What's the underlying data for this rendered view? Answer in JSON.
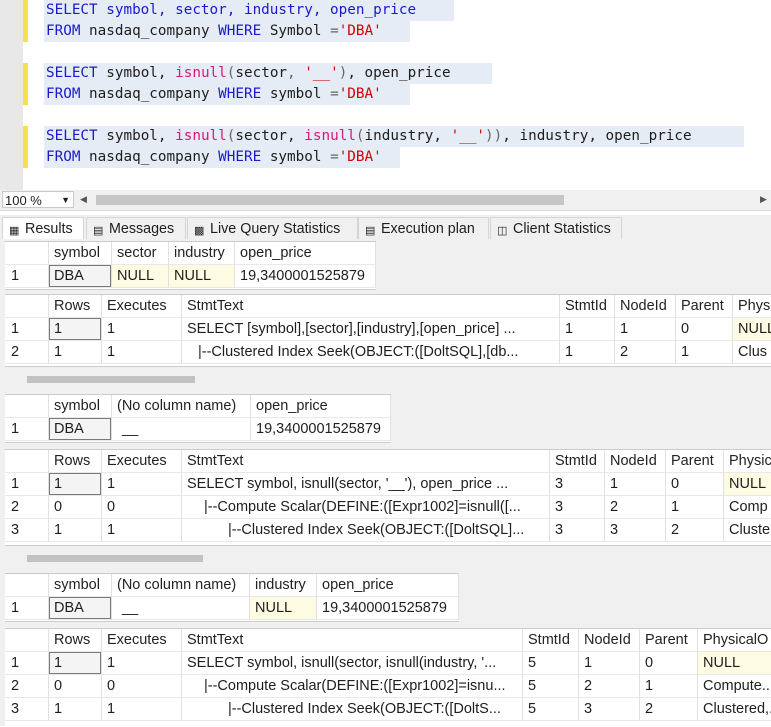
{
  "editor": {
    "q1_select": "SELECT symbol, sector, industry, open_price",
    "q1_from_kw1": "FROM",
    "q1_from_mid": " nasdaq_company ",
    "q1_where": "WHERE",
    "q1_col": " Symbol ",
    "q1_eq": "=",
    "q1_val": "'DBA'",
    "q2_sel_kw": "SELECT",
    "q2_a": " symbol, ",
    "q2_fn": "isnull",
    "q2_b": "(",
    "q2_c": "sector",
    "q2_d": ", ",
    "q2_str": "'__'",
    "q2_e": ")",
    "q2_f": ", open_price",
    "q2_from_kw1": "FROM",
    "q2_from_mid": " nasdaq_company ",
    "q2_where": "WHERE",
    "q2_col": " symbol ",
    "q2_eq": "=",
    "q2_val": "'DBA'",
    "q3_sel_kw": "SELECT",
    "q3_a": " symbol, ",
    "q3_fn1": "isnull",
    "q3_b": "(",
    "q3_c": "sector, ",
    "q3_fn2": "isnull",
    "q3_d": "(",
    "q3_e": "industry, ",
    "q3_str": "'__'",
    "q3_f": "))",
    "q3_g": ", industry, open_price",
    "q3_from_kw1": "FROM",
    "q3_from_mid": " nasdaq_company ",
    "q3_where": "WHERE",
    "q3_col": " symbol ",
    "q3_eq": "=",
    "q3_val": "'DBA'"
  },
  "zoom": {
    "value": "100 %"
  },
  "tabs": [
    "Results",
    "Messages",
    "Live Query Statistics",
    "Execution plan",
    "Client Statistics"
  ],
  "grid1": {
    "headers": [
      "symbol",
      "sector",
      "industry",
      "open_price"
    ],
    "row": [
      "1",
      "DBA",
      "NULL",
      "NULL",
      "19,3400001525879"
    ]
  },
  "plan1": {
    "headers": [
      "Rows",
      "Executes",
      "StmtText",
      "StmtId",
      "NodeId",
      "Parent",
      "Phys"
    ],
    "rows": [
      [
        "1",
        "1",
        "1",
        "SELECT [symbol],[sector],[industry],[open_price] ...",
        "1",
        "1",
        "0",
        "NULL"
      ],
      [
        "2",
        "1",
        "1",
        "|--Clustered Index Seek(OBJECT:([DoltSQL],[db...",
        "1",
        "2",
        "1",
        "Clus"
      ]
    ]
  },
  "grid2": {
    "headers": [
      "symbol",
      "(No column name)",
      "open_price"
    ],
    "row": [
      "1",
      "DBA",
      "__",
      "19,3400001525879"
    ]
  },
  "plan2": {
    "headers": [
      "Rows",
      "Executes",
      "StmtText",
      "StmtId",
      "NodeId",
      "Parent",
      "Physic"
    ],
    "rows": [
      [
        "1",
        "1",
        "1",
        "SELECT symbol, isnull(sector, '__'), open_price  ...",
        "3",
        "1",
        "0",
        "NULL"
      ],
      [
        "2",
        "0",
        "0",
        "|--Compute Scalar(DEFINE:([Expr1002]=isnull([...",
        "3",
        "2",
        "1",
        "Comp"
      ],
      [
        "3",
        "1",
        "1",
        "|--Clustered Index Seek(OBJECT:([DoltSQL]...",
        "3",
        "3",
        "2",
        "Cluste"
      ]
    ]
  },
  "grid3": {
    "headers": [
      "symbol",
      "(No column name)",
      "industry",
      "open_price"
    ],
    "row": [
      "1",
      "DBA",
      "__",
      "NULL",
      "19,3400001525879"
    ]
  },
  "plan3": {
    "headers": [
      "Rows",
      "Executes",
      "StmtText",
      "StmtId",
      "NodeId",
      "Parent",
      "PhysicalO"
    ],
    "rows": [
      [
        "1",
        "1",
        "1",
        "SELECT symbol, isnull(sector, isnull(industry, '...",
        "5",
        "1",
        "0",
        "NULL"
      ],
      [
        "2",
        "0",
        "0",
        "|--Compute Scalar(DEFINE:([Expr1002]=isnu...",
        "5",
        "2",
        "1",
        "Compute..."
      ],
      [
        "3",
        "1",
        "1",
        "|--Clustered Index Seek(OBJECT:([DoltS...",
        "5",
        "3",
        "2",
        "Clustered,..."
      ]
    ]
  }
}
